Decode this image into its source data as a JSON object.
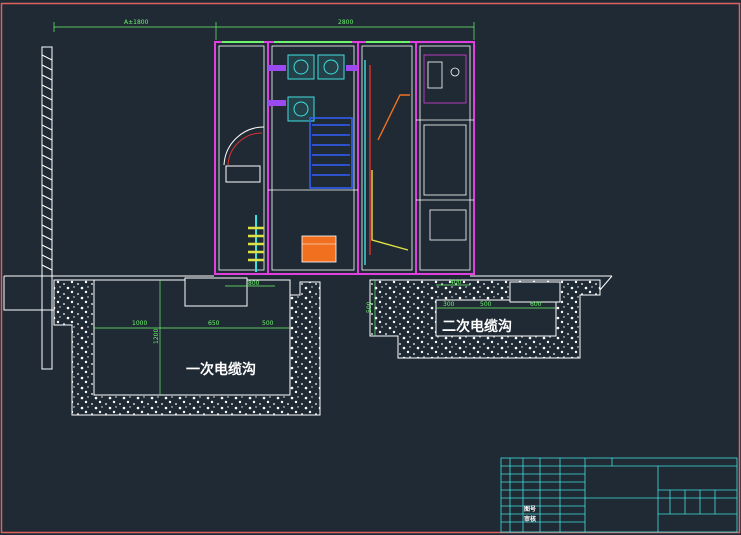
{
  "drawing": {
    "frame_color": "#e06060",
    "panel_color": "#e040e0",
    "dim_color": "#6cf56c",
    "cable_color": "#ffffff"
  },
  "dimensions": {
    "total_width": "2800",
    "left_extent": "A±1800",
    "pad_width": "800",
    "trench1_w1": "1000",
    "trench1_w2": "650",
    "trench1_w3": "500",
    "trench1_depth": "1200",
    "trench2_w0": "400",
    "trench2_w1": "300",
    "trench2_w2": "500",
    "trench2_w3": "600",
    "trench2_depth": "500"
  },
  "labels": {
    "primary_trench": "一次电缆沟",
    "secondary_trench": "二次电缆沟"
  },
  "title_block": {
    "cell_a": "图号",
    "cell_b": "审核"
  }
}
